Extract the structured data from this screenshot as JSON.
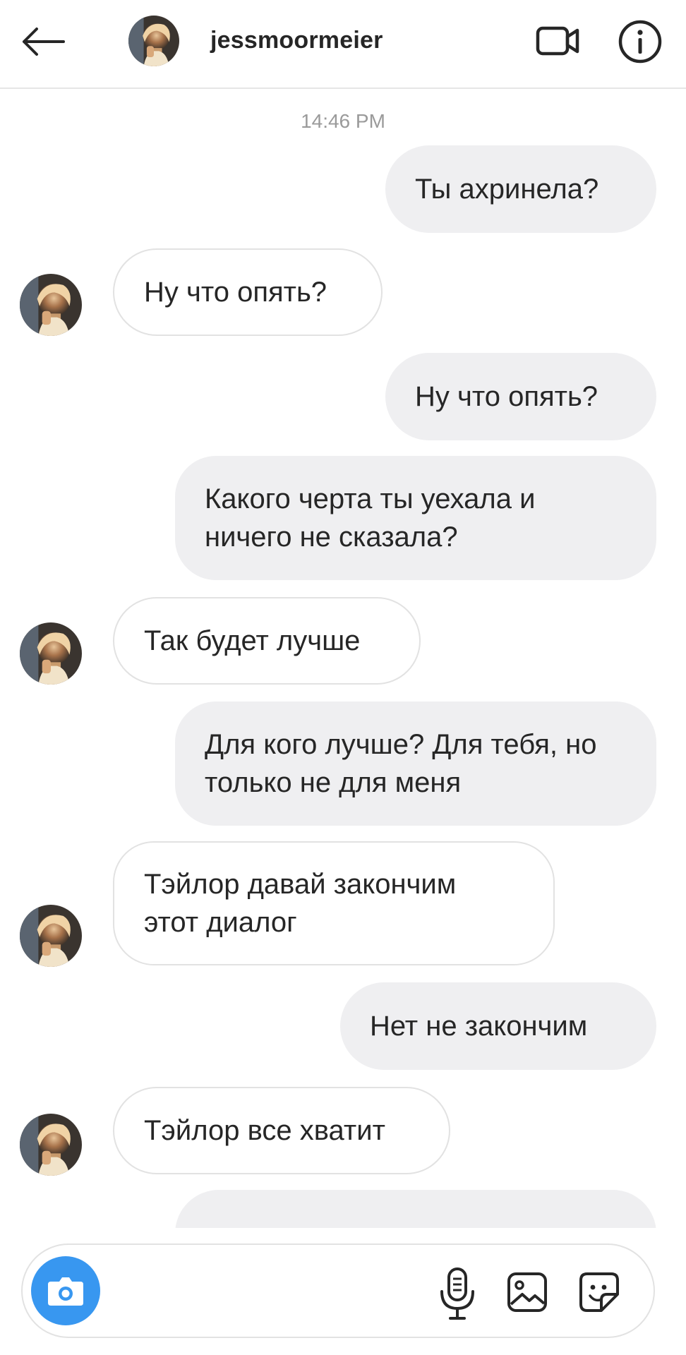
{
  "header": {
    "username": "jessmoormeier",
    "icons": {
      "back": "back-arrow-icon",
      "video": "video-call-icon",
      "info": "info-icon"
    }
  },
  "timestamp": "14:46 PM",
  "messages": [
    {
      "from": "me",
      "text": "Ты ахринела?"
    },
    {
      "from": "them",
      "text": "Ну что опять?"
    },
    {
      "from": "me",
      "text": "Ну что опять?"
    },
    {
      "from": "me",
      "text": "Какого черта ты уехала и ничего не сказала?"
    },
    {
      "from": "them",
      "text": "Так будет лучше"
    },
    {
      "from": "me",
      "text": "Для кого лучше? Для тебя, но только не для меня"
    },
    {
      "from": "them",
      "text": "Тэйлор давай закончим этот диалог"
    },
    {
      "from": "me",
      "text": "Нет не закончим"
    },
    {
      "from": "them",
      "text": "Тэйлор все хватит"
    },
    {
      "from": "me",
      "text": ""
    }
  ],
  "composer": {
    "placeholder": "",
    "icons": {
      "camera": "camera-icon",
      "mic": "microphone-icon",
      "gallery": "gallery-icon",
      "sticker": "sticker-icon"
    }
  },
  "colors": {
    "accent": "#3897f0",
    "sent_bubble": "#efeff1",
    "border": "#e2e2e2",
    "text": "#262626",
    "muted": "#9a9a9a"
  }
}
